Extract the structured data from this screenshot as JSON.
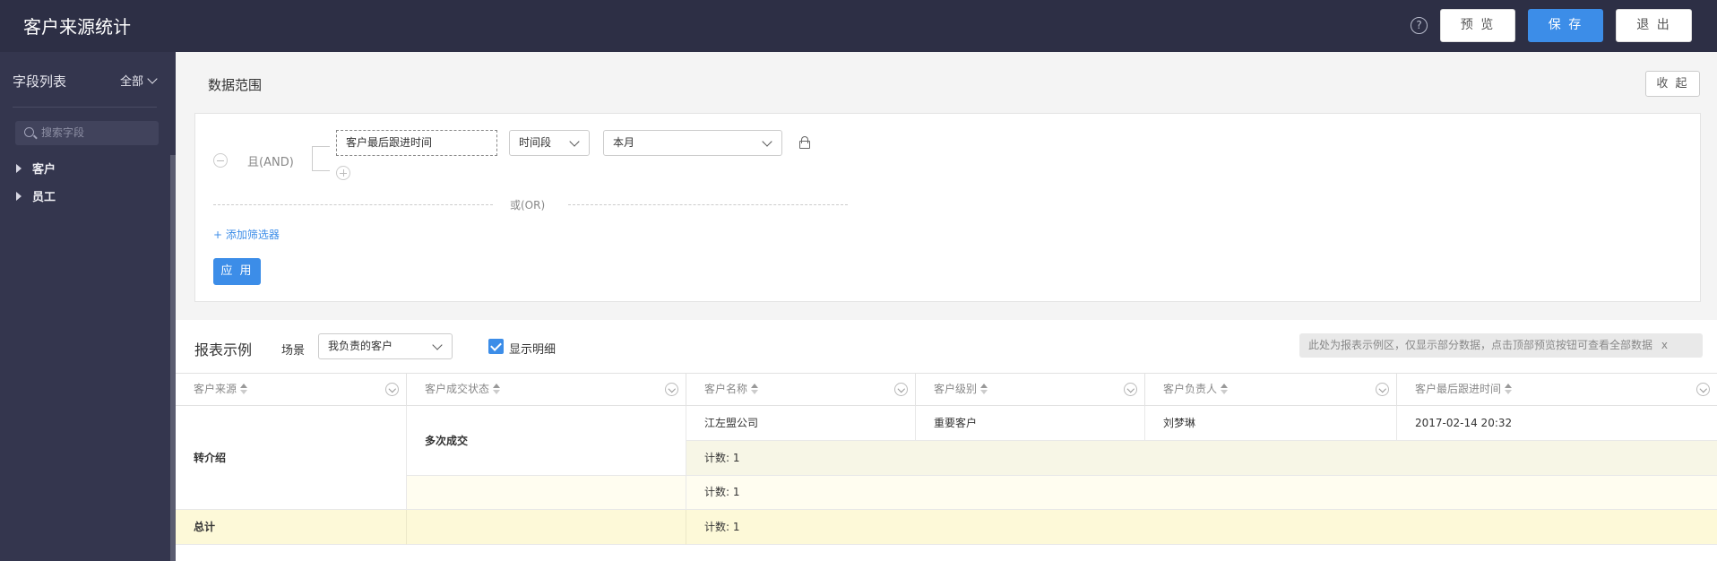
{
  "header": {
    "title": "客户来源统计",
    "help_icon": "?",
    "preview_label": "预 览",
    "save_label": "保 存",
    "exit_label": "退 出"
  },
  "sidebar": {
    "title": "字段列表",
    "filter_label": "全部",
    "search_placeholder": "搜索字段",
    "items": [
      {
        "label": "客户"
      },
      {
        "label": "员工"
      }
    ]
  },
  "data_range": {
    "title": "数据范围",
    "collapse_label": "收 起",
    "and_label": "且(AND)",
    "field": "客户最后跟进时间",
    "operator": "时间段",
    "value": "本月",
    "or_label": "或(OR)",
    "add_filter": "+ 添加筛选器",
    "apply_label": "应 用"
  },
  "report": {
    "title": "报表示例",
    "scene_label": "场景",
    "scene_value": "我负责的客户",
    "show_detail_label": "显示明细",
    "show_detail_checked": true,
    "notice": "此处为报表示例区，仅显示部分数据，点击顶部预览按钮可查看全部数据",
    "notice_close": "x",
    "columns": [
      "客户来源",
      "客户成交状态",
      "客户名称",
      "客户级别",
      "客户负责人",
      "客户最后跟进时间"
    ],
    "rows": {
      "source": "转介绍",
      "status": "多次成交",
      "name": "江左盟公司",
      "level": "重要客户",
      "owner": "刘梦琳",
      "last_follow": "2017-02-14 20:32",
      "count_status": "计数: 1",
      "count_source": "计数: 1",
      "total_label": "总计",
      "count_total": "计数: 1"
    }
  },
  "colors": {
    "header_bg": "#2d2f45",
    "sidebar_bg": "#34364e",
    "accent": "#3c8de8",
    "subtotal_bg": "#f7f6e6",
    "total_bg": "#fdf9d8"
  }
}
